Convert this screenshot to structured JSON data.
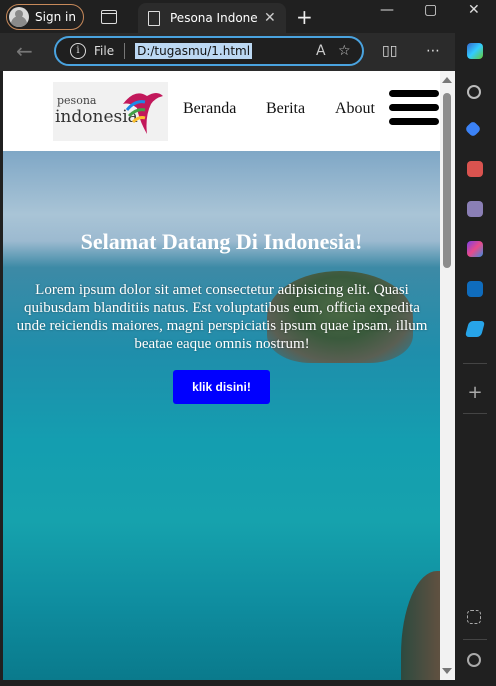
{
  "browser": {
    "sign_in_label": "Sign in",
    "tab_title": "Pesona Indonesia",
    "address_prefix": "File",
    "url": "D:/tugasmu/1.html"
  },
  "site": {
    "logo": {
      "line1": "pesona",
      "line2": "indonesia"
    },
    "nav": [
      "Beranda",
      "Berita",
      "About"
    ]
  },
  "hero": {
    "title": "Selamat Datang Di Indonesia!",
    "body": "Lorem ipsum dolor sit amet consectetur adipisicing elit. Quasi quibusdam blanditiis natus. Est voluptatibus eum, officia expedita unde reiciendis maiores, magni perspiciatis ipsum quae ipsam, illum beatae eaque omnis nostrum!",
    "button_label": "klik disini!",
    "button_color": "#0000ff"
  }
}
